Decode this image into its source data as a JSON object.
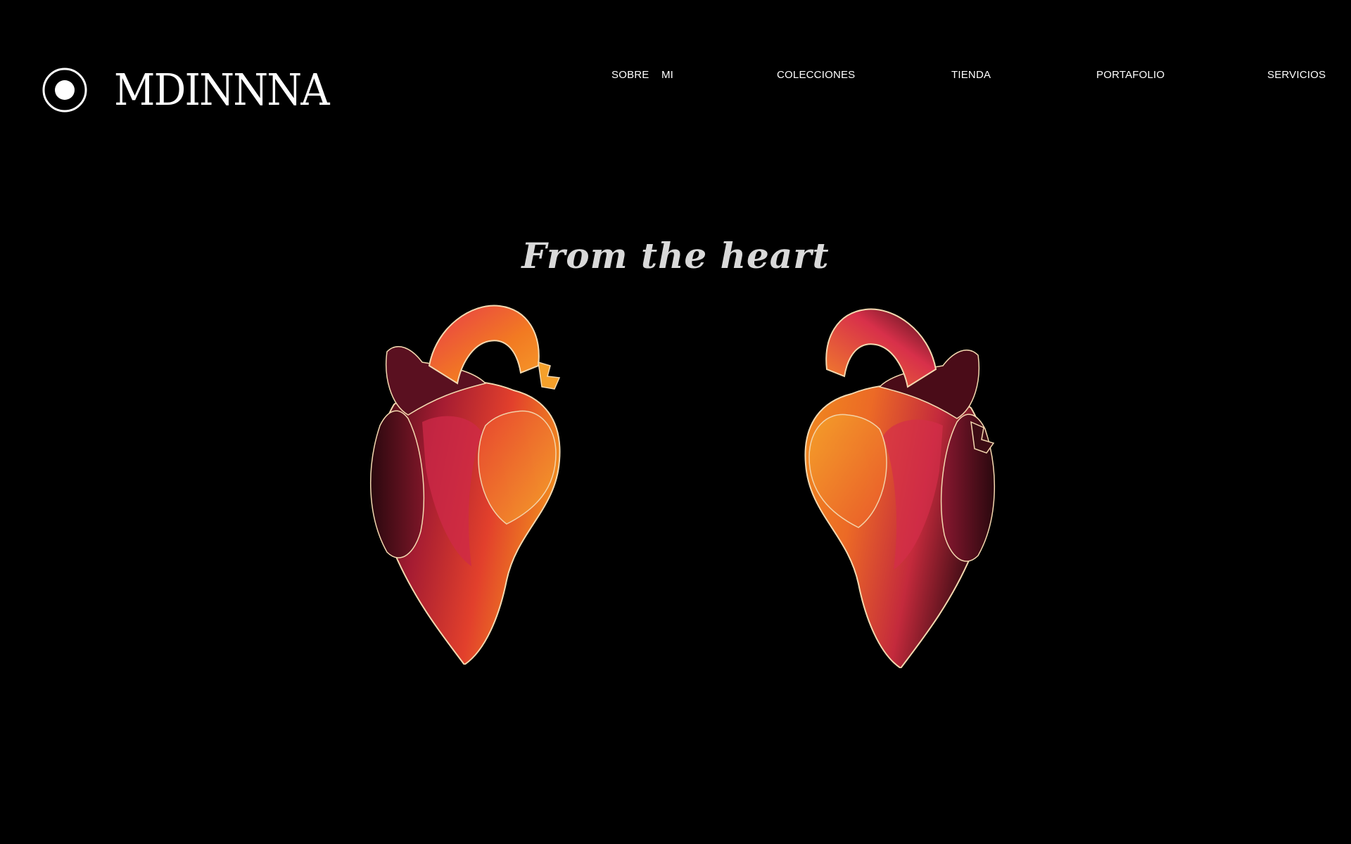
{
  "brand": {
    "name": "MDINNNA",
    "logo_icon": "circle-dot-icon"
  },
  "nav": {
    "items": [
      {
        "label": "SOBRE    MI"
      },
      {
        "label": "COLECCIONES"
      },
      {
        "label": "TIENDA"
      },
      {
        "label": "PORTAFOLIO"
      },
      {
        "label": "SERVICIOS"
      }
    ]
  },
  "hero": {
    "tagline": "From the heart",
    "artworks": [
      {
        "name": "painted-anatomical-heart-left"
      },
      {
        "name": "painted-anatomical-heart-right"
      }
    ]
  },
  "colors": {
    "background": "#000000",
    "text": "#ffffff",
    "tagline": "#d9d9d9",
    "heart_orange": "#f0821e",
    "heart_red": "#d2283c",
    "heart_dark": "#3c0c14"
  }
}
